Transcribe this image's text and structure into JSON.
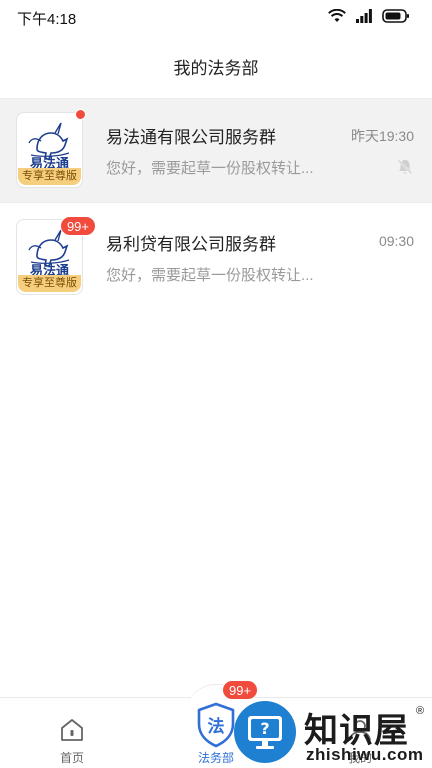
{
  "status_bar": {
    "time": "下午4:18",
    "icons": [
      "wifi-icon",
      "signal-icon",
      "battery-icon"
    ]
  },
  "header": {
    "title": "我的法务部"
  },
  "chats": [
    {
      "brand": "易法通",
      "tag": "专享至尊版",
      "name": "易法通有限公司服务群",
      "preview": "您好，需要起草一份股权转让...",
      "time": "昨天19:30",
      "unread": "dot",
      "muted": true
    },
    {
      "brand": "易法通",
      "tag": "专享至尊版",
      "name": "易利贷有限公司服务群",
      "preview": "您好，需要起草一份股权转让...",
      "time": "09:30",
      "unread": "99+",
      "muted": false
    }
  ],
  "tabs": [
    {
      "label": "首页",
      "icon": "home-icon",
      "active": false
    },
    {
      "label": "法务部",
      "icon": "legal-shield-icon",
      "icon_char": "法",
      "badge": "99+",
      "active": true
    },
    {
      "label": "我的",
      "icon": "user-icon",
      "active": false
    }
  ],
  "watermark": {
    "text": "知识屋",
    "domain": "zhishiwu.com",
    "reg": "®",
    "icon_char": "?"
  },
  "colors": {
    "accent": "#2f6fd6",
    "badge": "#f04b3c",
    "tag": "#f6cf7e",
    "brand": "#1e3f8f",
    "watermark_blue": "#1f7fd1"
  }
}
